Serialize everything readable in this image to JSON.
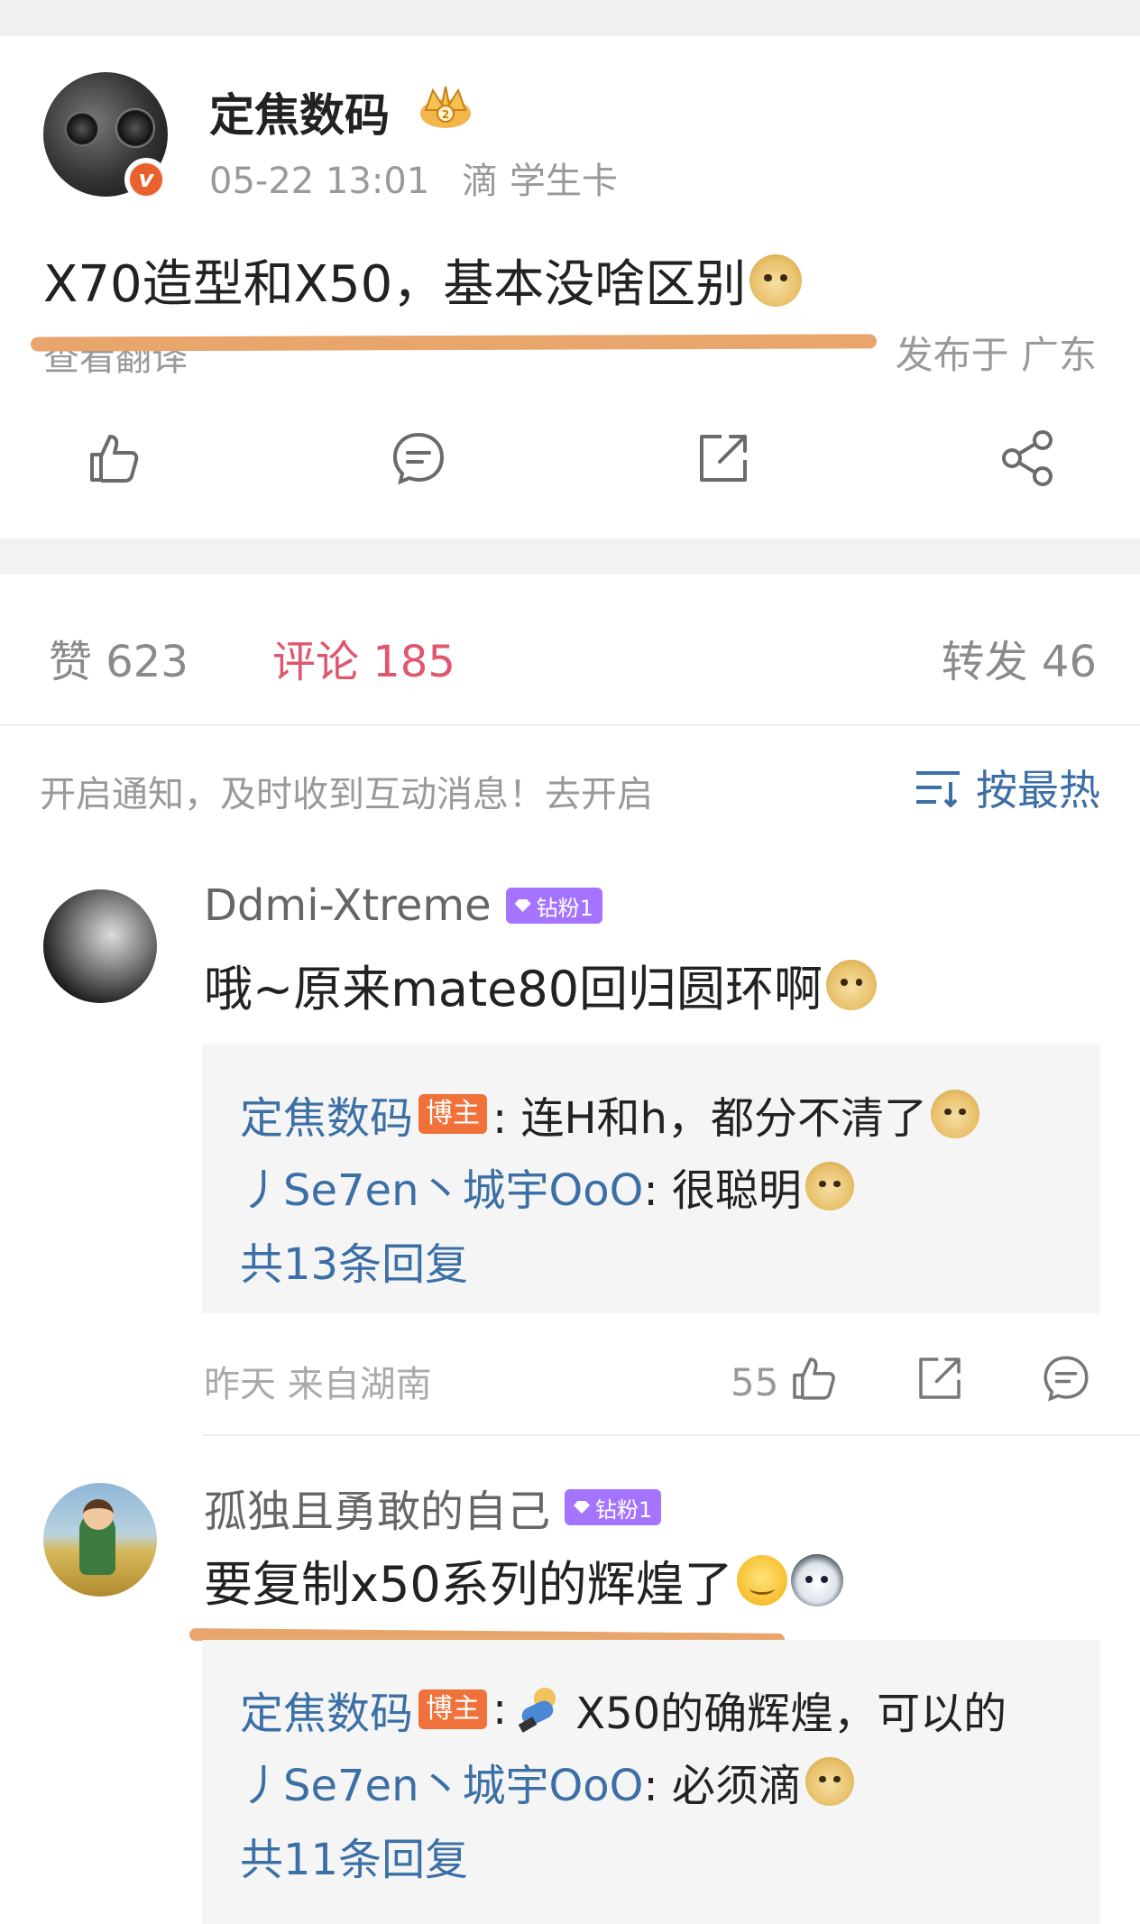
{
  "post": {
    "author": "定焦数码",
    "time": "05-22 13:01",
    "source": "滴 学生卡",
    "text": "X70造型和X50，基本没啥区别",
    "translate": "查看翻译",
    "location": "发布于 广东",
    "actions": [
      "like-icon",
      "comment-icon",
      "repost-icon",
      "share-icon"
    ]
  },
  "stats": {
    "likes": "赞 623",
    "comments": "评论 185",
    "reposts": "转发 46"
  },
  "notify": {
    "text": "开启通知，及时收到互动消息！去开启",
    "sort": "按最热"
  },
  "comments": [
    {
      "name": "Ddmi-Xtreme",
      "badge": "钻粉1",
      "text": "哦~原来mate80回归圆环啊",
      "replies": [
        {
          "user": "定焦数码",
          "host": "博主",
          "text": ": 连H和h，都分不清了"
        },
        {
          "user": "丿Se7en丶城宇OoO",
          "text": " : 很聪明"
        }
      ],
      "reply_count": "共13条回复",
      "meta": "昨天  来自湖南",
      "likes": "55"
    },
    {
      "name": "孤独且勇敢的自己",
      "badge": "钻粉1",
      "text": "要复制x50系列的辉煌了",
      "replies": [
        {
          "user": "定焦数码",
          "host": "博主",
          "text": "X50的确辉煌，可以的"
        },
        {
          "user": "丿Se7en丶城宇OoO",
          "text": " : 必须滴"
        }
      ],
      "reply_count": "共11条回复"
    }
  ],
  "colors": {
    "link_blue": "#3b6fa6",
    "comment_pink": "#e0566e",
    "highlight_orange": "#e8a56c",
    "host_badge": "#f0713a",
    "fan_badge": "#a474ff"
  }
}
